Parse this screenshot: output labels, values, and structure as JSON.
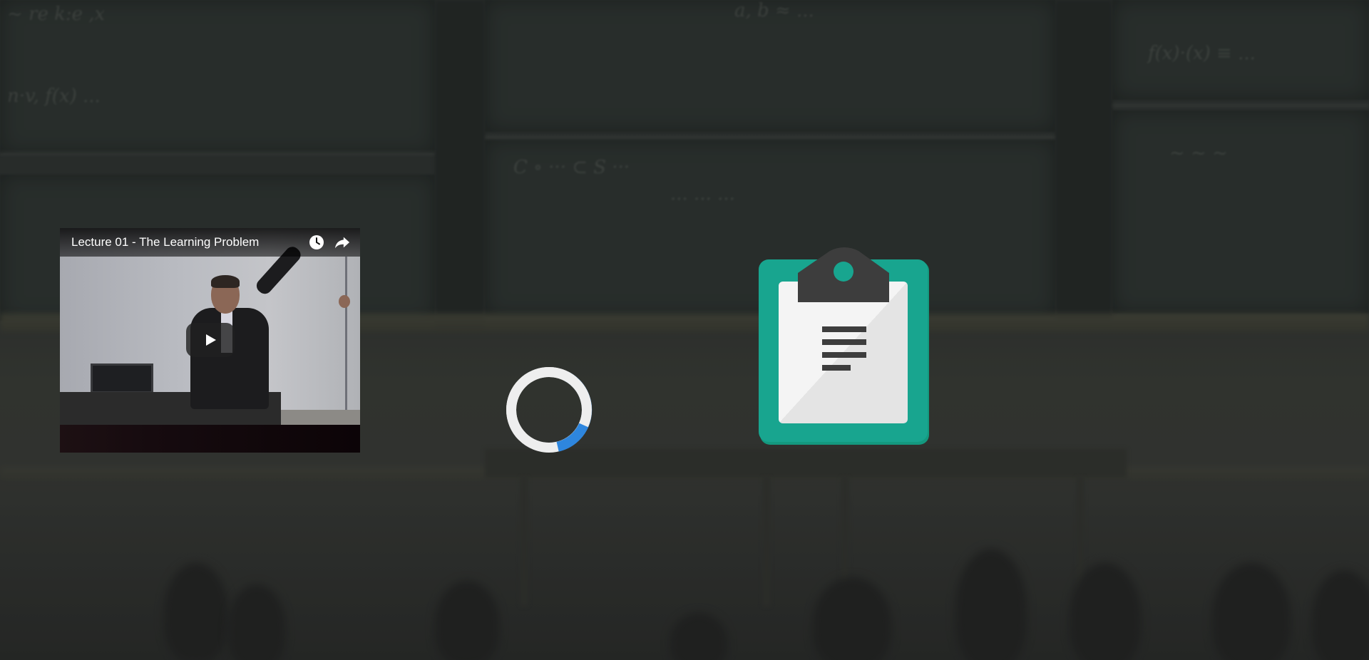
{
  "background": {
    "description_color": "#2f3331"
  },
  "video_card": {
    "title": "Lecture 01 - The Learning Problem",
    "watch_later_icon": "clock-icon",
    "share_icon": "share-arrow-icon",
    "play_icon": "play-icon"
  },
  "loading_spinner": {
    "icon": "loading-spinner",
    "track_color": "#eeeeee",
    "accent_color": "#2e86de"
  },
  "clipboard_icon": {
    "icon": "clipboard-icon",
    "board_color": "#18a58f",
    "paper_color": "#f2f2f2",
    "clip_color": "#3d3d3d"
  }
}
